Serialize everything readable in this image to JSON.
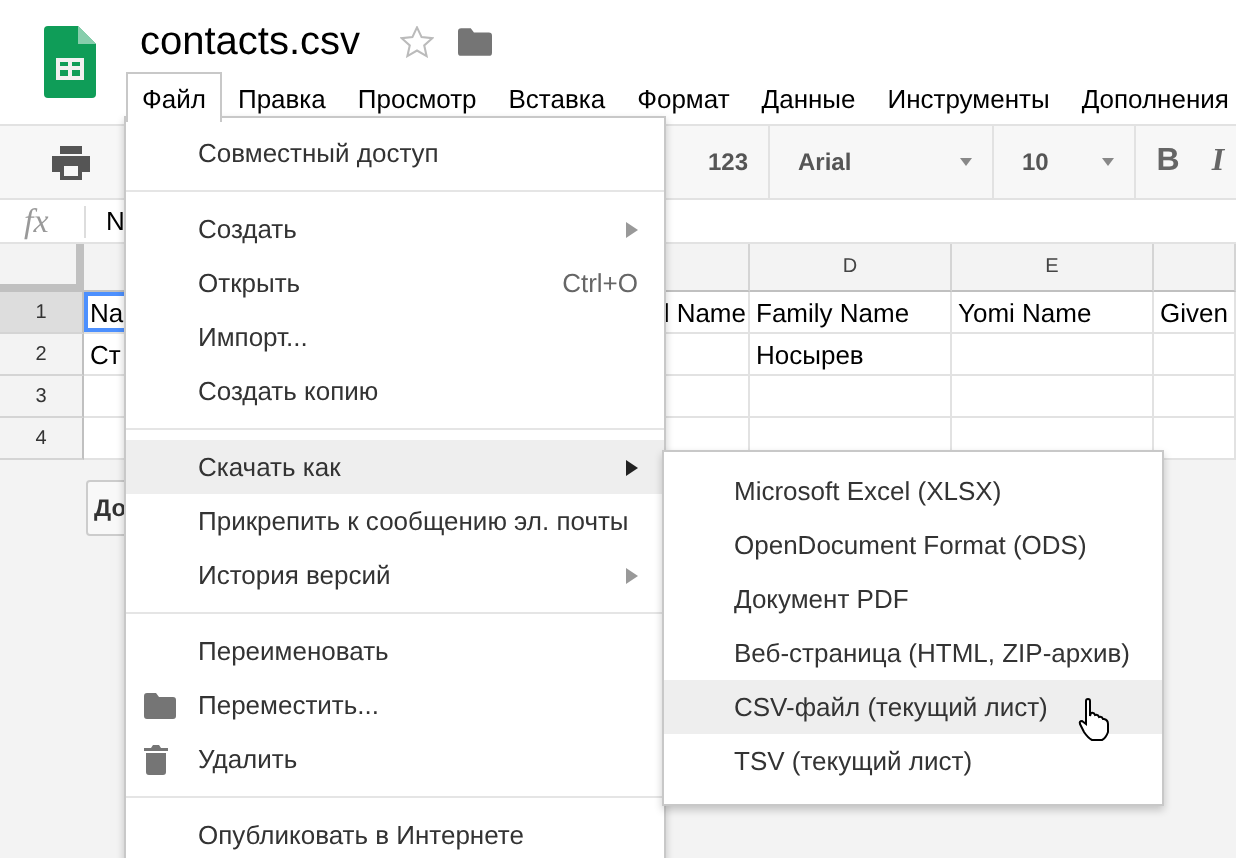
{
  "document": {
    "title": "contacts.csv"
  },
  "menu_bar": [
    {
      "label": "Файл",
      "selected": true
    },
    {
      "label": "Правка",
      "selected": false
    },
    {
      "label": "Просмотр",
      "selected": false
    },
    {
      "label": "Вставка",
      "selected": false
    },
    {
      "label": "Формат",
      "selected": false
    },
    {
      "label": "Данные",
      "selected": false
    },
    {
      "label": "Инструменты",
      "selected": false
    },
    {
      "label": "Дополнения",
      "selected": false
    }
  ],
  "toolbar": {
    "number_format": "123",
    "font": "Arial",
    "font_size": "10",
    "bold": "B",
    "italic": "I"
  },
  "formula_bar": {
    "label": "fx",
    "value": "N"
  },
  "grid": {
    "column_headers": [
      "D",
      "E"
    ],
    "rows": [
      {
        "number": "1",
        "selected": true,
        "cells": [
          "Na",
          "l Name",
          "Family Name",
          "Yomi Name",
          "Given"
        ]
      },
      {
        "number": "2",
        "selected": false,
        "cells": [
          "Ст",
          null,
          "Носырев",
          null,
          null
        ]
      },
      {
        "number": "3",
        "selected": false
      },
      {
        "number": "4",
        "selected": false
      }
    ]
  },
  "sheet_button": "До",
  "file_menu": {
    "items": [
      {
        "kind": "plain",
        "label": "Совместный доступ",
        "selected": false
      },
      {
        "kind": "divider"
      },
      {
        "kind": "plain",
        "label": "Создать",
        "submenu": true,
        "selected": false
      },
      {
        "kind": "plain",
        "label": "Открыть",
        "shortcut": "Ctrl+O",
        "selected": false
      },
      {
        "kind": "plain",
        "label": "Импорт...",
        "selected": false
      },
      {
        "kind": "plain",
        "label": "Создать копию",
        "selected": false
      },
      {
        "kind": "divider"
      },
      {
        "kind": "plain",
        "label": "Скачать как",
        "submenu": true,
        "selected": true
      },
      {
        "kind": "plain",
        "label": "Прикрепить к сообщению эл. почты",
        "selected": false
      },
      {
        "kind": "plain",
        "label": "История версий",
        "submenu": true,
        "selected": false
      },
      {
        "kind": "divider"
      },
      {
        "kind": "plain",
        "label": "Переименовать",
        "selected": false
      },
      {
        "kind": "folder",
        "label": "Переместить...",
        "selected": false
      },
      {
        "kind": "trash",
        "label": "Удалить",
        "selected": false
      },
      {
        "kind": "divider"
      },
      {
        "kind": "plain",
        "label": "Опубликовать в Интернете",
        "selected": false
      }
    ]
  },
  "download_submenu": {
    "items": [
      {
        "label": "Microsoft Excel (XLSX)",
        "selected": false
      },
      {
        "label": "OpenDocument Format (ODS)",
        "selected": false
      },
      {
        "label": "Документ PDF",
        "selected": false
      },
      {
        "label": "Веб-страница (HTML, ZIP-архив)",
        "selected": false
      },
      {
        "label": "CSV-файл (текущий лист)",
        "selected": true
      },
      {
        "label": "TSV (текущий лист)",
        "selected": false
      }
    ]
  }
}
